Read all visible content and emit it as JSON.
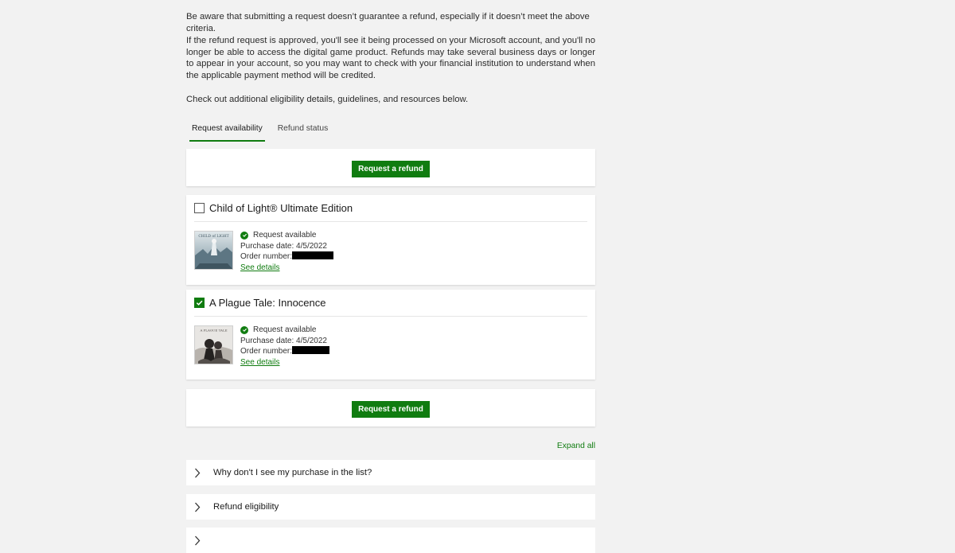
{
  "intro": {
    "p1": "Be aware that submitting a request doesn’t guarantee a refund, especially if it doesn’t meet the above criteria.",
    "p2": "If the refund request is approved, you'll see it being processed on your Microsoft account, and you'll no longer be able to access the digital game product. Refunds may take several business days or longer to appear in your account, so you may want to check with your financial institution to understand when the applicable payment method will be credited.",
    "p3": "Check out additional eligibility details, guidelines, and resources below."
  },
  "tabs": [
    {
      "label": "Request availability",
      "active": true
    },
    {
      "label": "Refund status",
      "active": false
    }
  ],
  "buttons": {
    "request_refund_top": "Request a refund",
    "request_refund_bottom": "Request a refund"
  },
  "items": [
    {
      "title": "Child of Light® Ultimate Edition",
      "checked": false,
      "status": "Request available",
      "purchase_label": "Purchase date:",
      "purchase_date": "4/5/2022",
      "order_label": "Order number:",
      "details_link": "See details",
      "thumb_text": "CHILD of LIGHT"
    },
    {
      "title": "A Plague Tale: Innocence",
      "checked": true,
      "status": "Request available",
      "purchase_label": "Purchase date:",
      "purchase_date": "4/5/2022",
      "order_label": "Order number:",
      "details_link": "See details",
      "thumb_text": "A PLAGUE TALE"
    }
  ],
  "expand_all": "Expand all",
  "faq": [
    {
      "question": "Why don't I see my purchase in the list?"
    },
    {
      "question": "Refund eligibility"
    },
    {
      "question": ""
    }
  ],
  "colors": {
    "accent": "#107c10",
    "background": "#f2f2f2",
    "card": "#ffffff"
  },
  "icons": {
    "check": "check-icon",
    "status": "check-circle-icon",
    "chevron": "chevron-right-icon"
  }
}
